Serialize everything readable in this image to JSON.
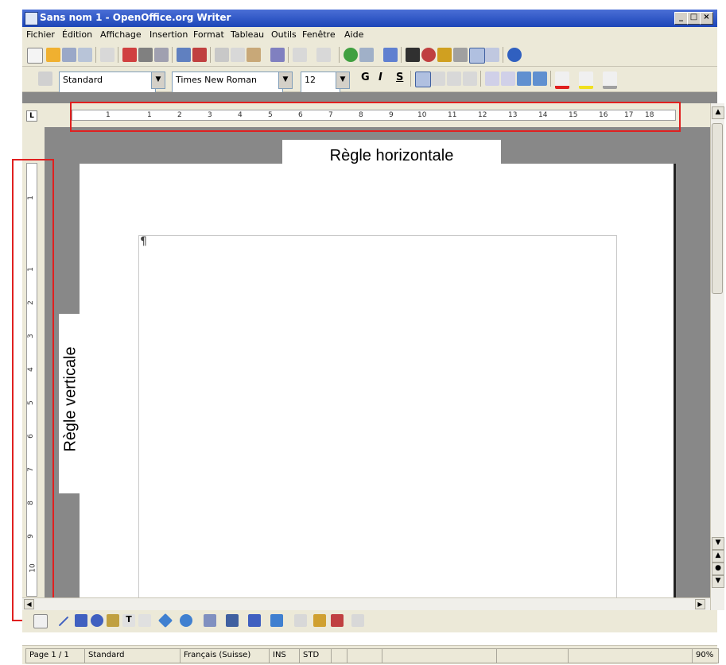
{
  "window": {
    "title": "Sans nom 1 - OpenOffice.org Writer",
    "controls": [
      "_",
      "□",
      "×"
    ]
  },
  "menu": [
    "Fichier",
    "Édition",
    "Affichage",
    "Insertion",
    "Format",
    "Tableau",
    "Outils",
    "Fenêtre",
    "Aide"
  ],
  "formatting": {
    "style": "Standard",
    "font": "Times New Roman",
    "size": "12",
    "bold": "G",
    "italic": "I",
    "underline": "S"
  },
  "rulers": {
    "corner": "L",
    "horizontal_ticks": [
      "1",
      "1",
      "2",
      "3",
      "4",
      "5",
      "6",
      "7",
      "8",
      "9",
      "10",
      "11",
      "12",
      "13",
      "14",
      "15",
      "16",
      "17",
      "18"
    ],
    "vertical_ticks": [
      "1",
      "1",
      "2",
      "3",
      "4",
      "5",
      "6",
      "7",
      "8",
      "9",
      "10"
    ]
  },
  "annotations": {
    "horizontal": "Règle horizontale",
    "vertical": "Règle verticale",
    "color": "#e02020"
  },
  "document": {
    "pilcrow": "¶"
  },
  "statusbar": {
    "page": "Page 1 / 1",
    "style": "Standard",
    "language": "Français (Suisse)",
    "insert": "INS",
    "selection": "STD",
    "zoom": "90%"
  },
  "icons": {
    "toolbar1": [
      "new-document-icon",
      "open-icon",
      "save-icon",
      "email-icon",
      "edit-file-icon",
      "export-pdf-icon",
      "print-icon",
      "page-preview-icon",
      "spellcheck-icon",
      "autospellcheck-icon",
      "cut-icon",
      "copy-icon",
      "paste-icon",
      "clone-format-icon",
      "undo-icon",
      "redo-icon",
      "hyperlink-icon",
      "table-icon",
      "show-draw-functions-icon",
      "find-replace-icon",
      "navigator-icon",
      "gallery-icon",
      "data-sources-icon",
      "nonprinting-chars-icon",
      "zoom-icon",
      "help-icon"
    ],
    "toolbar2": [
      "styles-icon",
      "align-left-icon",
      "align-center-icon",
      "align-right-icon",
      "justify-icon",
      "numbering-icon",
      "bullets-icon",
      "decrease-indent-icon",
      "increase-indent-icon",
      "font-color-icon",
      "highlight-icon",
      "background-color-icon"
    ]
  }
}
